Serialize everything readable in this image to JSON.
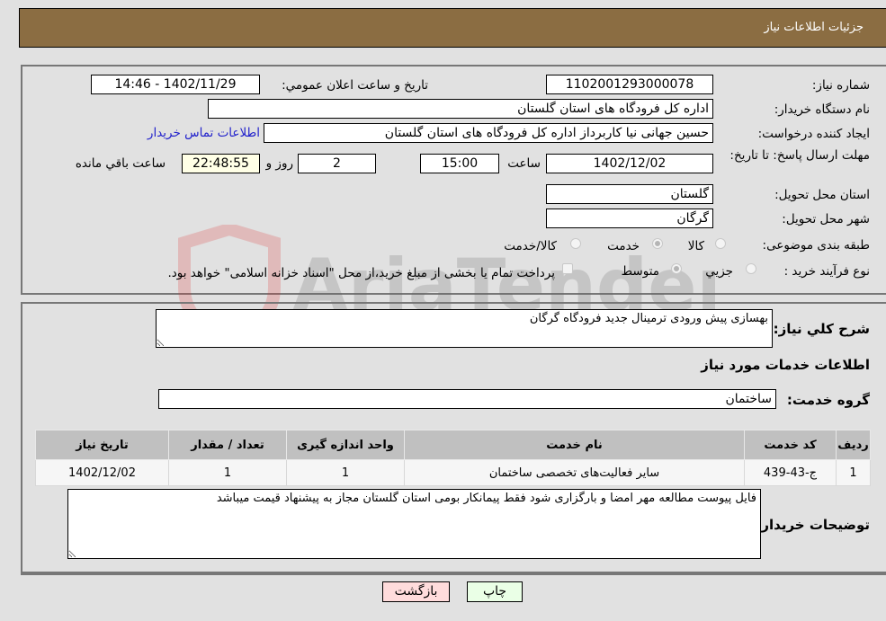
{
  "header": {
    "title": "جزئیات اطلاعات نیاز"
  },
  "fields": {
    "need_number": {
      "label": "شماره نیاز:",
      "value": "1102001293000078"
    },
    "announce_datetime": {
      "label": "تاریخ و ساعت اعلان عمومي:",
      "value": "1402/11/29 - 14:46"
    },
    "buyer_org": {
      "label": "نام دستگاه خریدار:",
      "value": "اداره کل فرودگاه های استان گلستان"
    },
    "requester": {
      "label": "ایجاد کننده درخواست:",
      "value": "حسین  جهانی نیا کاربرداز اداره کل فرودگاه های استان گلستان"
    },
    "buyer_contact_link": "اطلاعات تماس خریدار",
    "deadline": {
      "label": "مهلت ارسال پاسخ: تا تاریخ:",
      "date": "1402/12/02",
      "time_label": "ساعت",
      "time": "15:00",
      "days": "2",
      "days_label": "روز و",
      "remaining": "22:48:55",
      "remaining_label": "ساعت باقي مانده"
    },
    "province": {
      "label": "استان محل تحویل:",
      "value": "گلستان"
    },
    "city": {
      "label": "شهر محل تحویل:",
      "value": "گرگان"
    },
    "category": {
      "label": "طبقه بندی موضوعی:",
      "options": [
        "کالا",
        "خدمت",
        "کالا/خدمت"
      ],
      "selected": "خدمت"
    },
    "purchase_type": {
      "label": "نوع فرآیند خرید :",
      "options": [
        "جزيي",
        "متوسط"
      ],
      "selected": "متوسط",
      "treasury_checkbox_label": "پرداخت تمام یا بخشی از مبلغ خرید،از محل \"اسناد خزانه اسلامی\" خواهد بود.",
      "treasury_checked": false
    }
  },
  "details": {
    "description_label": "شرح کلي نیاز:",
    "description": "بهسازی پیش ورودی ترمینال جدید فرودگاه گرگان",
    "services_heading": "اطلاعات خدمات مورد نیاز",
    "service_group_label": "گروه خدمت:",
    "service_group": "ساختمان"
  },
  "table": {
    "columns": [
      "ردیف",
      "کد خدمت",
      "نام خدمت",
      "واحد اندازه گیری",
      "تعداد / مقدار",
      "تاریخ نیاز"
    ],
    "rows": [
      [
        "1",
        "ج-43-439",
        "سایر فعالیت‌های تخصصی ساختمان",
        "1",
        "1",
        "1402/12/02"
      ]
    ]
  },
  "buyer_notes": {
    "label": "توضیحات خریدار:",
    "value": "فایل پیوست مطالعه مهر امضا و بارگزاری شود فقط پیمانکار بومی استان گلستان مجاز به پیشنهاد قیمت میباشد"
  },
  "buttons": {
    "print": "چاپ",
    "back": "بازگشت"
  },
  "watermark": {
    "text": "AriaTender.neT"
  }
}
